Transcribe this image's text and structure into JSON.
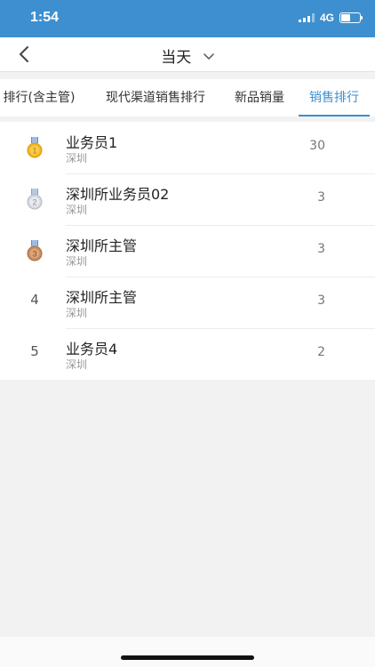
{
  "status_bar": {
    "time": "1:54",
    "network": "4G",
    "battery_level": 0.5
  },
  "nav": {
    "title": "当天"
  },
  "tabs": [
    {
      "label": "排行(含主管)",
      "active": false
    },
    {
      "label": "现代渠道销售排行",
      "active": false
    },
    {
      "label": "新品销量",
      "active": false
    },
    {
      "label": "销售排行",
      "active": true
    }
  ],
  "ranking": [
    {
      "rank": "1",
      "medal": "gold",
      "name": "业务员1",
      "area": "深圳",
      "value": "30"
    },
    {
      "rank": "2",
      "medal": "silver",
      "name": "深圳所业务员02",
      "area": "深圳",
      "value": "3"
    },
    {
      "rank": "3",
      "medal": "bronze",
      "name": "深圳所主管",
      "area": "深圳",
      "value": "3"
    },
    {
      "rank": "4",
      "medal": null,
      "name": "深圳所主管",
      "area": "深圳",
      "value": "3"
    },
    {
      "rank": "5",
      "medal": null,
      "name": "业务员4",
      "area": "深圳",
      "value": "2"
    }
  ],
  "colors": {
    "accent": "#3d8fcf",
    "gold": "#f2b51d",
    "silver": "#c9cdd6",
    "bronze": "#c98b5e"
  }
}
